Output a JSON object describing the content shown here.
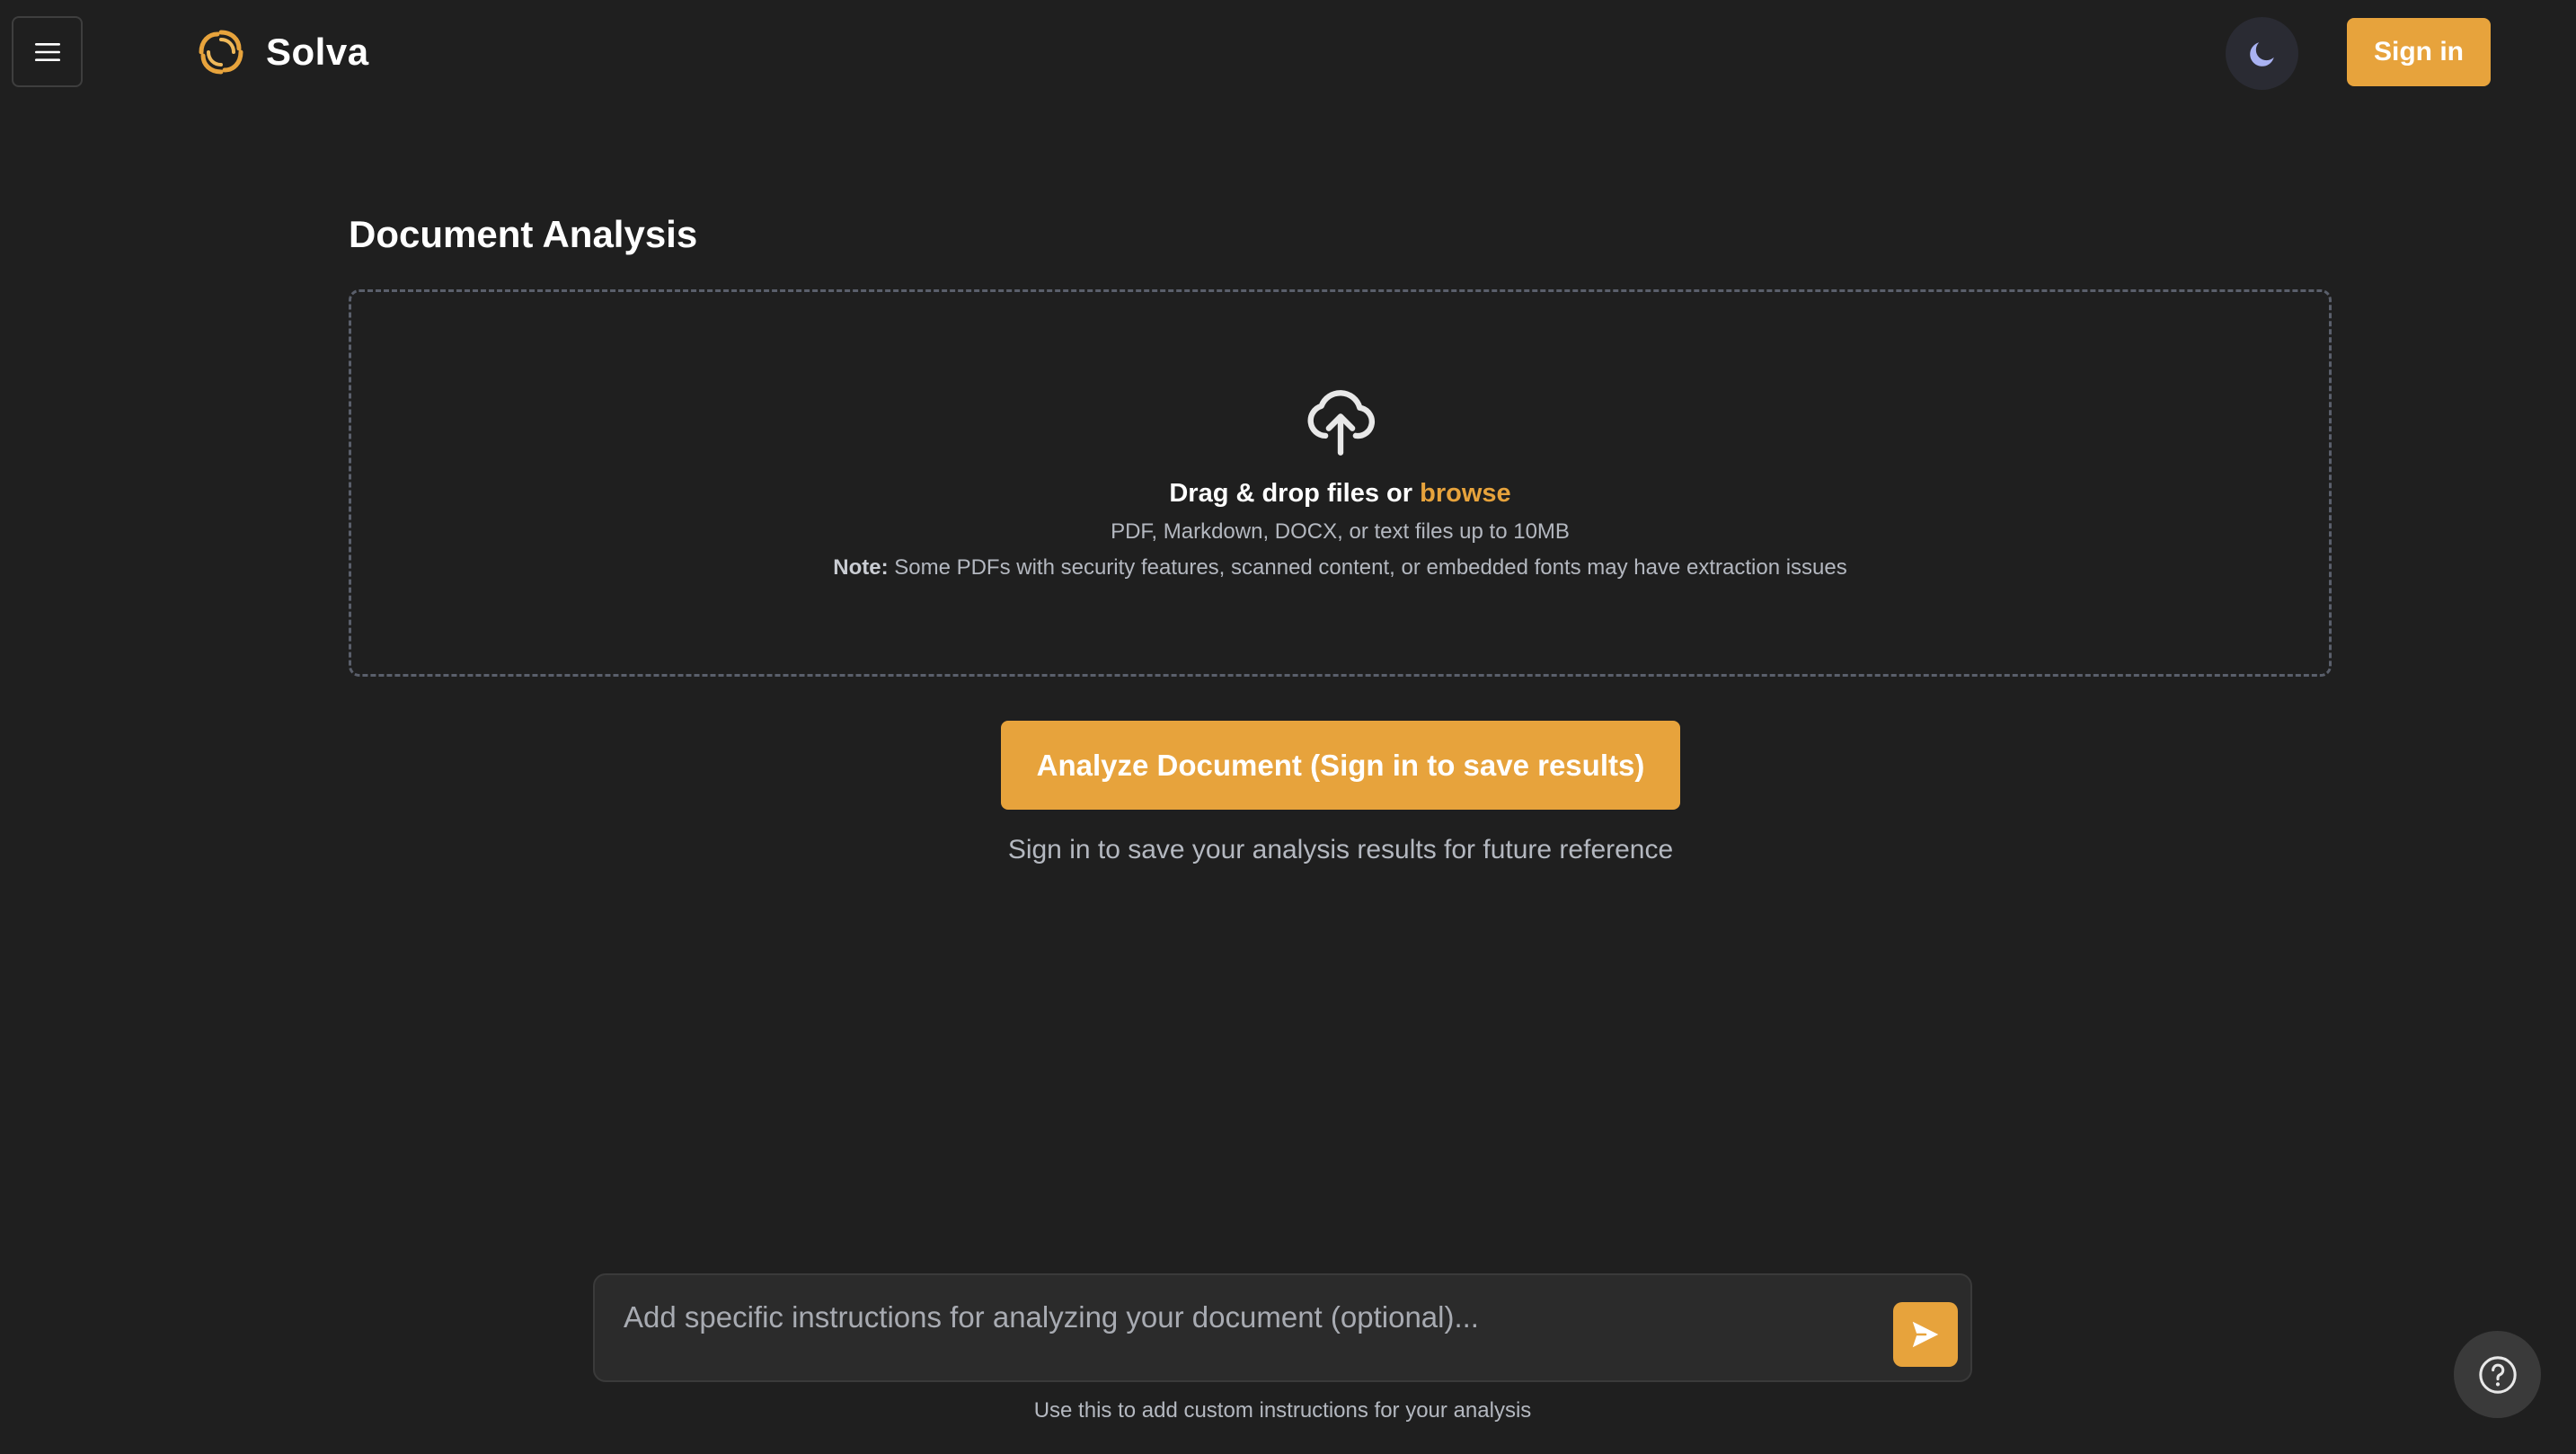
{
  "header": {
    "menu_icon": "hamburger-menu-icon",
    "logo_icon": "sun-spiral-logo-icon",
    "brand_name": "Solva",
    "theme_icon": "moon-icon",
    "sign_in_label": "Sign in"
  },
  "main": {
    "title": "Document Analysis",
    "dropzone": {
      "icon": "cloud-upload-icon",
      "drop_text": "Drag & drop files or ",
      "browse_label": "browse",
      "file_types": "PDF, Markdown, DOCX, or text files up to 10MB",
      "note_label": "Note:",
      "note_text": " Some PDFs with security features, scanned content, or embedded fonts may have extraction issues"
    },
    "analyze_button_label": "Analyze Document (Sign in to save results)",
    "sign_in_hint": "Sign in to save your analysis results for future reference"
  },
  "instructions": {
    "placeholder": "Add specific instructions for analyzing your document (optional)...",
    "value": "",
    "send_icon": "send-arrow-icon",
    "hint": "Use this to add custom instructions for your analysis"
  },
  "help": {
    "icon": "question-circle-icon"
  },
  "colors": {
    "background": "#1f1f1f",
    "accent": "#e7a33c",
    "muted_text": "#b4b8c0",
    "theme_toggle_bg": "#2a2b33",
    "moon": "#a9b2f2"
  }
}
